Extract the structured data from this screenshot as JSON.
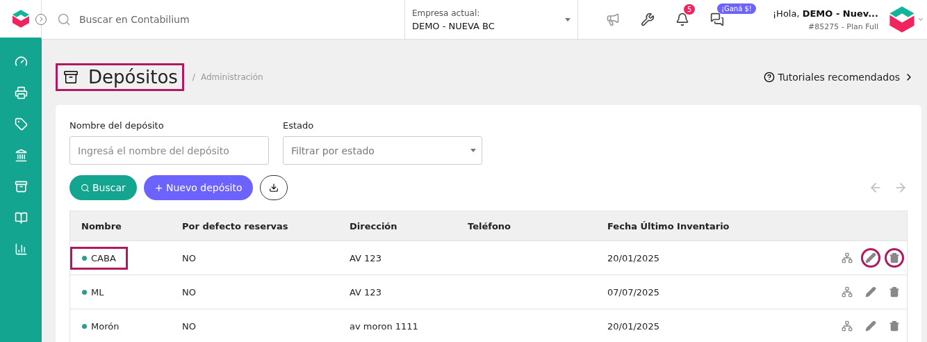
{
  "header": {
    "search_placeholder": "Buscar en Contabilium",
    "company_label": "Empresa actual:",
    "company_name": "DEMO - NUEVA BC",
    "notification_count": "5",
    "promo_badge": "¡Ganá $!",
    "greeting": "¡Hola, **DEMO - Nuev...**",
    "plan": "#85275 - Plan Full"
  },
  "page": {
    "title": "Depósitos",
    "title_highlighted": true,
    "breadcrumb_separator": "/",
    "breadcrumb": "Administración",
    "tutorials_link": "Tutoriales recomendados"
  },
  "filters": [
    {
      "kind": "text",
      "label": "Nombre del depósito",
      "placeholder": "Ingresá el nombre del depósito"
    },
    {
      "kind": "select",
      "label": "Estado",
      "placeholder": "Filtrar por estado"
    }
  ],
  "buttons": [
    {
      "kind": "search",
      "label": "Buscar"
    },
    {
      "kind": "new",
      "label": "+ Nuevo depósito"
    },
    {
      "kind": "download"
    }
  ],
  "table": {
    "columns": [
      "Nombre",
      "Por defecto reservas",
      "Dirección",
      "Teléfono",
      "Fecha Último Inventario"
    ],
    "rows": [
      {
        "name": "CABA",
        "color": "#2a9d8f",
        "default_reserves": "NO",
        "address": "AV 123",
        "date": "20/01/2025",
        "name_highlighted": true,
        "edit_highlighted": true,
        "delete_highlighted": true
      },
      {
        "name": "ML",
        "color": "#2a9d8f",
        "default_reserves": "NO",
        "address": "AV 123",
        "date": "07/07/2025",
        "name_highlighted": false,
        "edit_highlighted": false,
        "delete_highlighted": false
      },
      {
        "name": "Morón",
        "color": "#2a9d8f",
        "default_reserves": "NO",
        "address": "av moron 1111",
        "date": "20/01/2025",
        "name_highlighted": false,
        "edit_highlighted": false,
        "delete_highlighted": false
      }
    ]
  }
}
